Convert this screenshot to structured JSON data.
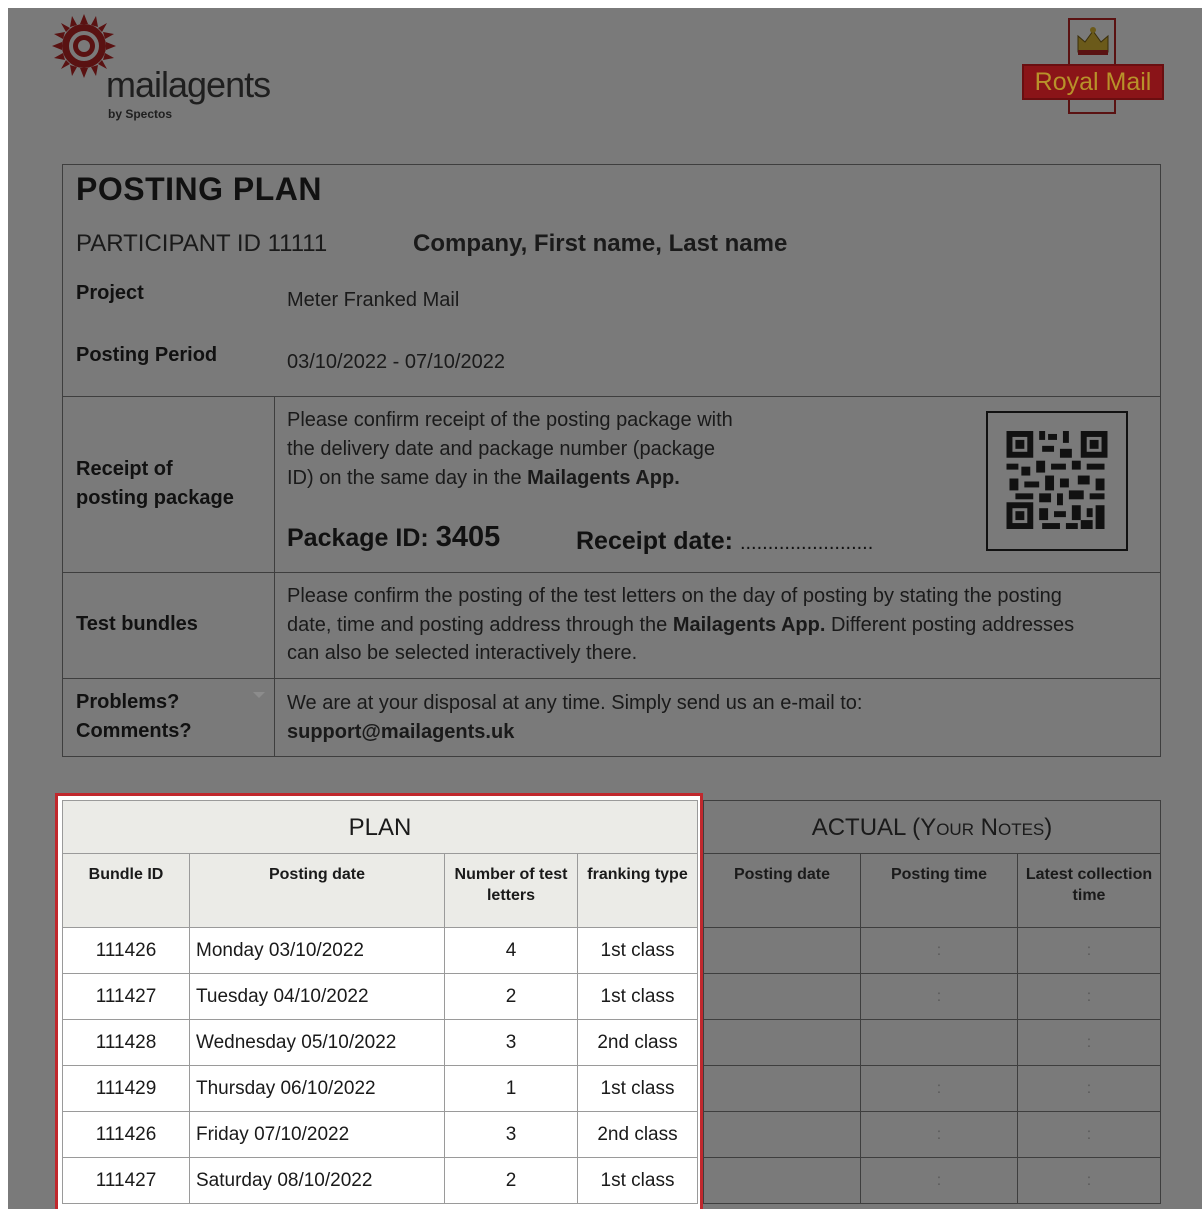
{
  "header": {
    "logo_text": "mailagents",
    "logo_sub": "by Spectos",
    "royal_mail": "Royal Mail"
  },
  "info": {
    "title": "POSTING PLAN",
    "participant_label": "PARTICIPANT ID 11111",
    "participant_name": "Company, First name, Last name",
    "project_label": "Project",
    "project_value": "Meter Franked Mail",
    "period_label": "Posting Period",
    "period_value": "03/10/2022 - 07/10/2022",
    "receipt_label_1": "Receipt of",
    "receipt_label_2": "posting package",
    "receipt_text_1": "Please confirm receipt of the posting package with",
    "receipt_text_2": "the delivery date and package number (package",
    "receipt_text_3a": "ID) on the same day in the ",
    "receipt_text_3b": "Mailagents App.",
    "package_id_label": "Package ID: ",
    "package_id_value": "3405",
    "receipt_date_label": "Receipt date: ",
    "receipt_date_dots": "........................",
    "bundles_label": "Test bundles",
    "bundles_text_1": "Please confirm the posting of the test letters on the day of posting by stating the posting",
    "bundles_text_2a": "date, time and posting address through the ",
    "bundles_text_2b": "Mailagents App.",
    "bundles_text_2c": " Different posting addresses",
    "bundles_text_3": "can also be selected interactively there.",
    "problems_label_1": "Problems?",
    "problems_label_2": "Comments?",
    "problems_text": "We are at your disposal at any time. Simply send us an e-mail to:",
    "support_email": "support@mailagents.uk"
  },
  "plan": {
    "title": "PLAN",
    "headers": [
      "Bundle ID",
      "Posting date",
      "Number of test letters",
      "franking type"
    ],
    "rows": [
      [
        "111426",
        "Monday 03/10/2022",
        "4",
        "1st class"
      ],
      [
        "111427",
        "Tuesday 04/10/2022",
        "2",
        "1st class"
      ],
      [
        "111428",
        "Wednesday 05/10/2022",
        "3",
        "2nd class"
      ],
      [
        "111429",
        "Thursday 06/10/2022",
        "1",
        "1st class"
      ],
      [
        "111426",
        "Friday 07/10/2022",
        "3",
        "2nd class"
      ],
      [
        "111427",
        "Saturday 08/10/2022",
        "2",
        "1st class"
      ]
    ]
  },
  "actual": {
    "title_a": "ACTUAL (",
    "title_b": "Your Notes",
    "title_c": ")",
    "headers": [
      "Posting date",
      "Posting time",
      "Latest collection time"
    ],
    "rows": [
      [
        "",
        ":",
        ":"
      ],
      [
        "",
        ":",
        ":"
      ],
      [
        "",
        "",
        ":"
      ],
      [
        "",
        ":",
        ":"
      ],
      [
        "",
        ":",
        ":"
      ],
      [
        "",
        ":",
        ":"
      ]
    ]
  },
  "colors": {
    "overlay": "#7a7a7a",
    "highlight_border": "#c0282d",
    "royal_mail_red": "#a8191e"
  }
}
